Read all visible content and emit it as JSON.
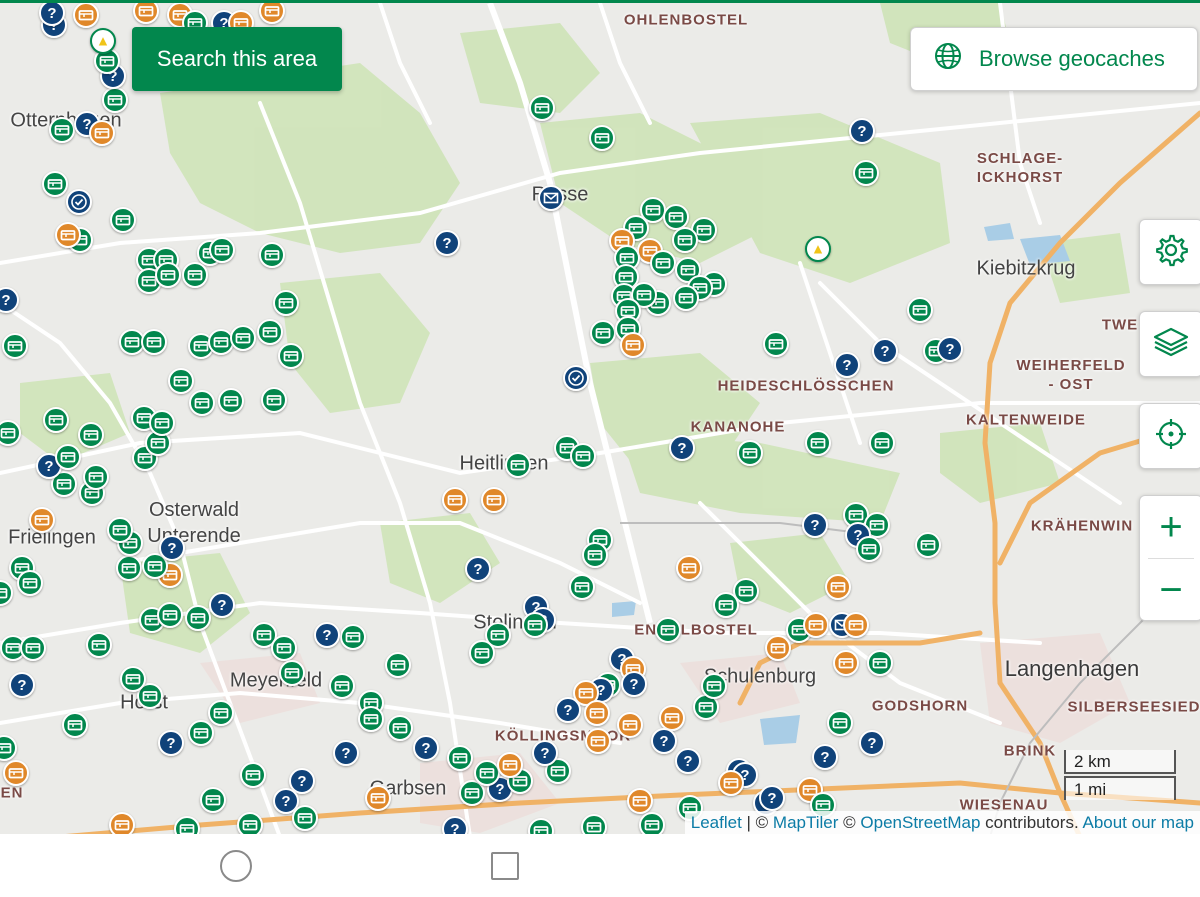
{
  "toolbar": {
    "search_area_label": "Search this area",
    "browse_label": "Browse geocaches"
  },
  "places": {
    "ohlenbostel": "OHLENBOSTEL",
    "schlage_ickhorst": "SCHLAGE-\nICKHORST",
    "otternhagen": "Otternhagen",
    "resse": "Resse",
    "kiebitzkrug": "Kiebitzkrug",
    "twe": "TWE",
    "weiherfeld_ost": "WEIHERFELD\n- OST",
    "heideschloesschen": "HEIDESCHLÖSSCHEN",
    "kaltenweide": "KALTENWEIDE",
    "kananohe": "KANANOHE",
    "heitlingen": "Heitlingen",
    "osterwald": "Osterwald\nUnterende",
    "frielingen": "Frielingen",
    "kraehenwinkel": "KRÄHENWIN",
    "stelingen": "Stelingen",
    "engelbostel": "ENGELBOSTEL",
    "meyenfeld": "Meyenfeld",
    "schulenburg": "Schulenburg",
    "langenhagen": "Langenhagen",
    "godshorn": "GODSHORN",
    "silberseesiedlung": "SILBERSEESIED",
    "horst": "Horst",
    "koellingsmoor": "KÖLLINGSMOOR",
    "brink": "BRINK",
    "garbsen": "Garbsen",
    "wiesenau": "WIESENAU",
    "en": "EN"
  },
  "scale": {
    "metric": "2 km",
    "imperial": "1 mi"
  },
  "attribution": {
    "leaflet": "Leaflet",
    "sep1": " | © ",
    "maptiler": "MapTiler",
    "sep2": " © ",
    "osm": "OpenStreetMap",
    "contributors": " contributors. ",
    "about": "About our map"
  },
  "colors": {
    "brand_green": "#02874d",
    "traditional": "#02874d",
    "mystery": "#10437a",
    "multi": "#e0882a",
    "unknown_grey": "#9a9a9a"
  },
  "icons": {
    "browse": "globe-icon",
    "settings": "gear-icon",
    "layers": "layers-icon",
    "locate": "crosshair-icon",
    "traditional": "traditional-cache-icon",
    "mystery": "mystery-cache-icon",
    "multi": "multi-cache-icon",
    "letterbox": "letterbox-cache-icon",
    "event": "event-cache-icon",
    "webcam": "webcam-cache-icon"
  },
  "zoom": {
    "in_label": "+",
    "out_label": "−"
  }
}
